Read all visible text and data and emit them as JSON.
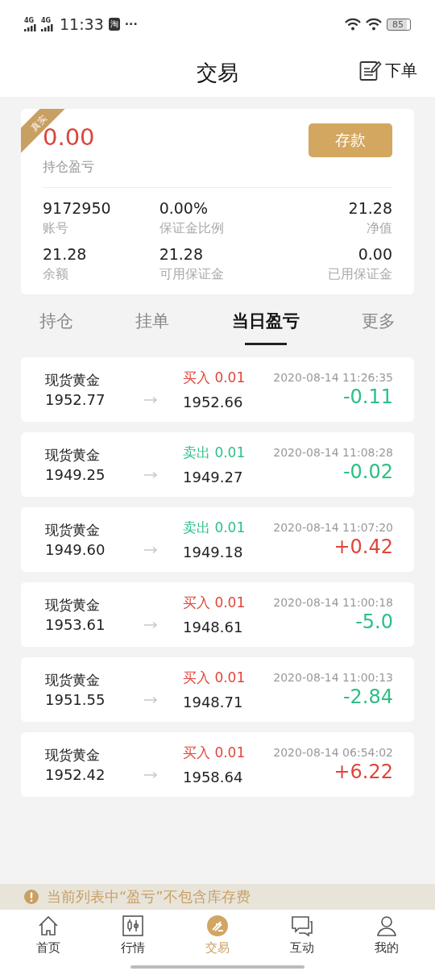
{
  "status_bar": {
    "network_1": "4G",
    "network_2": "4G",
    "time": "11:33",
    "app_badge": "淘",
    "more": "···",
    "battery": "85"
  },
  "header": {
    "title": "交易",
    "action": "下单"
  },
  "account": {
    "ribbon": "真实",
    "pnl": "0.00",
    "pnl_label": "持仓盈亏",
    "deposit_button": "存款",
    "stats": [
      {
        "value": "9172950",
        "label": "账号"
      },
      {
        "value": "0.00%",
        "label": "保证金比例"
      },
      {
        "value": "21.28",
        "label": "净值"
      },
      {
        "value": "21.28",
        "label": "余额"
      },
      {
        "value": "21.28",
        "label": "可用保证金"
      },
      {
        "value": "0.00",
        "label": "已用保证金"
      }
    ]
  },
  "tabs": [
    {
      "label": "持仓",
      "selected": false
    },
    {
      "label": "挂单",
      "selected": false
    },
    {
      "label": "当日盈亏",
      "selected": true
    },
    {
      "label": "更多",
      "selected": false
    }
  ],
  "trades": [
    {
      "product": "现货黄金",
      "open_price": "1952.77",
      "order": {
        "text": "买入 0.01",
        "color": "#e0463a"
      },
      "close_price": "1952.66",
      "time": "2020-08-14 11:26:35",
      "pnl": {
        "text": "-0.11",
        "color": "#2dbf86"
      }
    },
    {
      "product": "现货黄金",
      "open_price": "1949.25",
      "order": {
        "text": "卖出 0.01",
        "color": "#2dbf86"
      },
      "close_price": "1949.27",
      "time": "2020-08-14 11:08:28",
      "pnl": {
        "text": "-0.02",
        "color": "#2dbf86"
      }
    },
    {
      "product": "现货黄金",
      "open_price": "1949.60",
      "order": {
        "text": "卖出 0.01",
        "color": "#2dbf86"
      },
      "close_price": "1949.18",
      "time": "2020-08-14 11:07:20",
      "pnl": {
        "text": "+0.42",
        "color": "#e0463a"
      }
    },
    {
      "product": "现货黄金",
      "open_price": "1953.61",
      "order": {
        "text": "买入 0.01",
        "color": "#e0463a"
      },
      "close_price": "1948.61",
      "time": "2020-08-14 11:00:18",
      "pnl": {
        "text": "-5.0",
        "color": "#2dbf86"
      }
    },
    {
      "product": "现货黄金",
      "open_price": "1951.55",
      "order": {
        "text": "买入 0.01",
        "color": "#e0463a"
      },
      "close_price": "1948.71",
      "time": "2020-08-14 11:00:13",
      "pnl": {
        "text": "-2.84",
        "color": "#2dbf86"
      }
    },
    {
      "product": "现货黄金",
      "open_price": "1952.42",
      "order": {
        "text": "买入 0.01",
        "color": "#e0463a"
      },
      "close_price": "1958.64",
      "time": "2020-08-14 06:54:02",
      "pnl": {
        "text": "+6.22",
        "color": "#e0463a"
      }
    }
  ],
  "notice": "当前列表中“盈亏”不包含库存费",
  "bottom_nav": [
    {
      "label": "首页",
      "selected": false
    },
    {
      "label": "行情",
      "selected": false
    },
    {
      "label": "交易",
      "selected": true
    },
    {
      "label": "互动",
      "selected": false
    },
    {
      "label": "我的",
      "selected": false
    }
  ]
}
